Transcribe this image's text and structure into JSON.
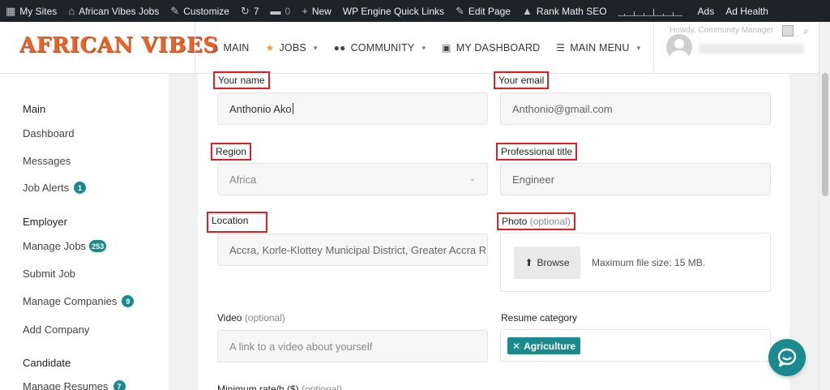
{
  "admin_bar": {
    "my_sites": "My Sites",
    "site_name": "African Vibes Jobs",
    "customize": "Customize",
    "updates_count": "7",
    "comments_count": "0",
    "new": "New",
    "wp_engine": "WP Engine Quick Links",
    "edit_page": "Edit Page",
    "rank_math": "Rank Math SEO",
    "ads": "Ads",
    "ad_health": "Ad Health"
  },
  "header": {
    "logo": "AFRICAN VIBES",
    "nav": [
      {
        "label": "MAIN",
        "icon": "home-icon"
      },
      {
        "label": "JOBS",
        "icon": "star-icon"
      },
      {
        "label": "COMMUNITY",
        "icon": "users-icon"
      },
      {
        "label": "MY DASHBOARD",
        "icon": "dashboard-icon"
      },
      {
        "label": "MAIN MENU",
        "icon": "list-icon"
      }
    ],
    "howdy": "Howdy, Community Manager"
  },
  "sidebar": {
    "main_heading": "Main",
    "dashboard": "Dashboard",
    "messages": "Messages",
    "job_alerts": "Job Alerts",
    "job_alerts_count": "1",
    "employer_heading": "Employer",
    "manage_jobs": "Manage Jobs",
    "manage_jobs_count": "253",
    "submit_job": "Submit Job",
    "manage_companies": "Manage Companies",
    "manage_companies_count": "9",
    "add_company": "Add Company",
    "candidate_heading": "Candidate",
    "manage_resumes": "Manage Resumes",
    "manage_resumes_count": "7"
  },
  "form": {
    "name_label": "Your name",
    "name_value": "Anthonio Ako",
    "email_label": "Your email",
    "email_value": "Anthonio@gmail.com",
    "region_label": "Region",
    "region_value": "Africa",
    "title_label": "Professional title",
    "title_value": "Engineer",
    "location_label": "Location",
    "location_value": "Accra, Korle-Klottey Municipal District, Greater Accra R",
    "photo_label": "Photo",
    "optional": "(optional)",
    "browse_label": "Browse",
    "max_file_size": "Maximum file size: 15 MB.",
    "video_label": "Video",
    "video_placeholder": "A link to a video about yourself",
    "resume_category_label": "Resume category",
    "resume_category_tag": "Agriculture",
    "min_rate_label": "Minimum rate/h ($)"
  },
  "colors": {
    "accent": "#1a8a8e",
    "logo": "#e8632a",
    "highlight_box": "#e02020",
    "admin_bar": "#1d2327"
  }
}
